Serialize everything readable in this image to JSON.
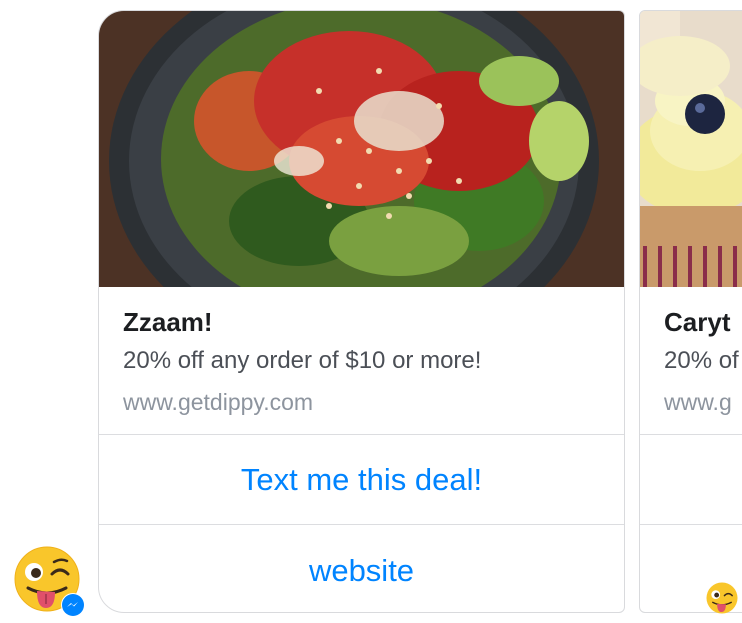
{
  "cards": [
    {
      "title": "Zzaam!",
      "subtitle": "20% off any order of $10 or more!",
      "url": "www.getdippy.com",
      "image": "salad-bowl",
      "buttons": [
        "Text me this deal!",
        "website"
      ]
    },
    {
      "title": "Caryt",
      "subtitle": "20% of",
      "url": "www.g",
      "image": "cupcake"
    }
  ],
  "icons": {
    "avatar": "winking-tongue-emoji",
    "badge": "messenger-icon",
    "reaction": "winking-tongue-emoji"
  },
  "colors": {
    "button_text": "#0084ff",
    "title": "#1c1e21",
    "subtitle": "#4b4f56",
    "url": "#8d949e",
    "border": "#d9dadd"
  }
}
